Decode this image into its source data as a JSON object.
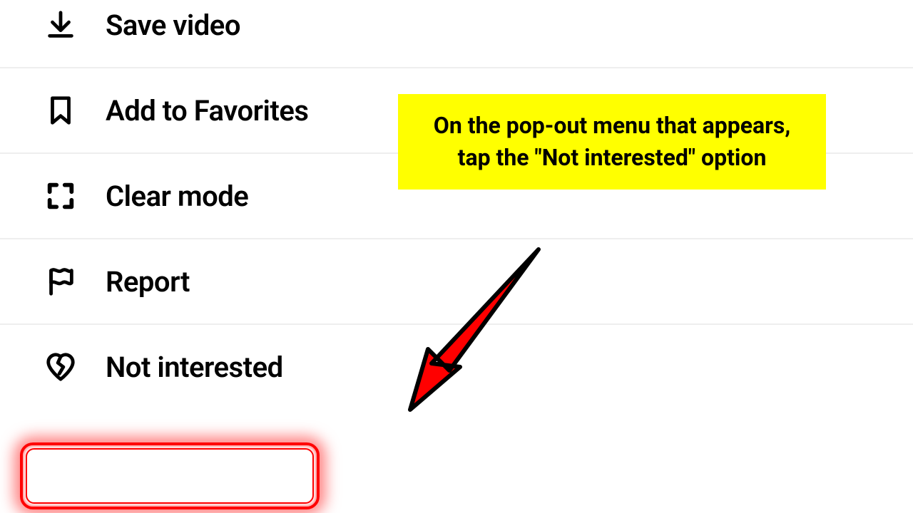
{
  "menu": {
    "items": [
      {
        "label": "Save video",
        "icon": "download-icon"
      },
      {
        "label": "Add to Favorites",
        "icon": "bookmark-icon"
      },
      {
        "label": "Clear mode",
        "icon": "fullscreen-icon"
      },
      {
        "label": "Report",
        "icon": "flag-icon"
      },
      {
        "label": "Not interested",
        "icon": "broken-heart-icon"
      }
    ]
  },
  "annotation": {
    "callout_text": "On the pop-out menu that appears, tap the \"Not interested\" option",
    "highlight_target": "not-interested-option",
    "colors": {
      "callout_bg": "#ffff00",
      "highlight": "#ff0000",
      "arrow": "#ff0000"
    }
  }
}
